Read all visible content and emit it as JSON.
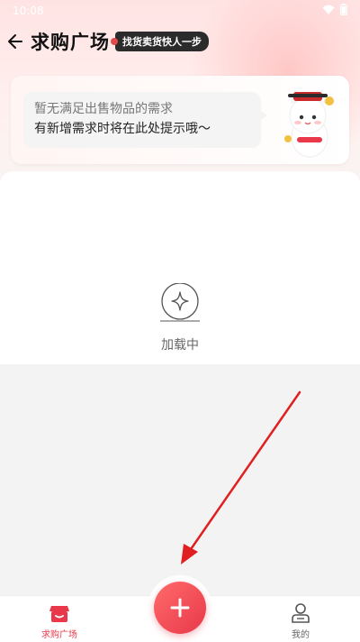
{
  "status_bar": {
    "time": "10:08",
    "wifi_icon": "wifi-icon",
    "battery_icon": "battery-icon"
  },
  "header": {
    "back_icon": "back-arrow-icon",
    "title": "求购广场",
    "slogan": "找货卖货快人一步"
  },
  "notice": {
    "line1": "暂无满足出售物品的需求",
    "line2": "有新增需求时将在此处提示哦～",
    "mascot": "cat-mascot-illustration"
  },
  "content": {
    "loading_icon": "sparkle-loading-icon",
    "loading_text": "加载中"
  },
  "tabbar": {
    "items": [
      {
        "label": "求购广场",
        "icon": "shop-icon",
        "active": true
      },
      {
        "label": "我的",
        "icon": "person-icon",
        "active": false
      }
    ],
    "fab_icon": "plus-icon"
  },
  "colors": {
    "accent": "#e8384a",
    "annotation_arrow": "#e02020"
  }
}
